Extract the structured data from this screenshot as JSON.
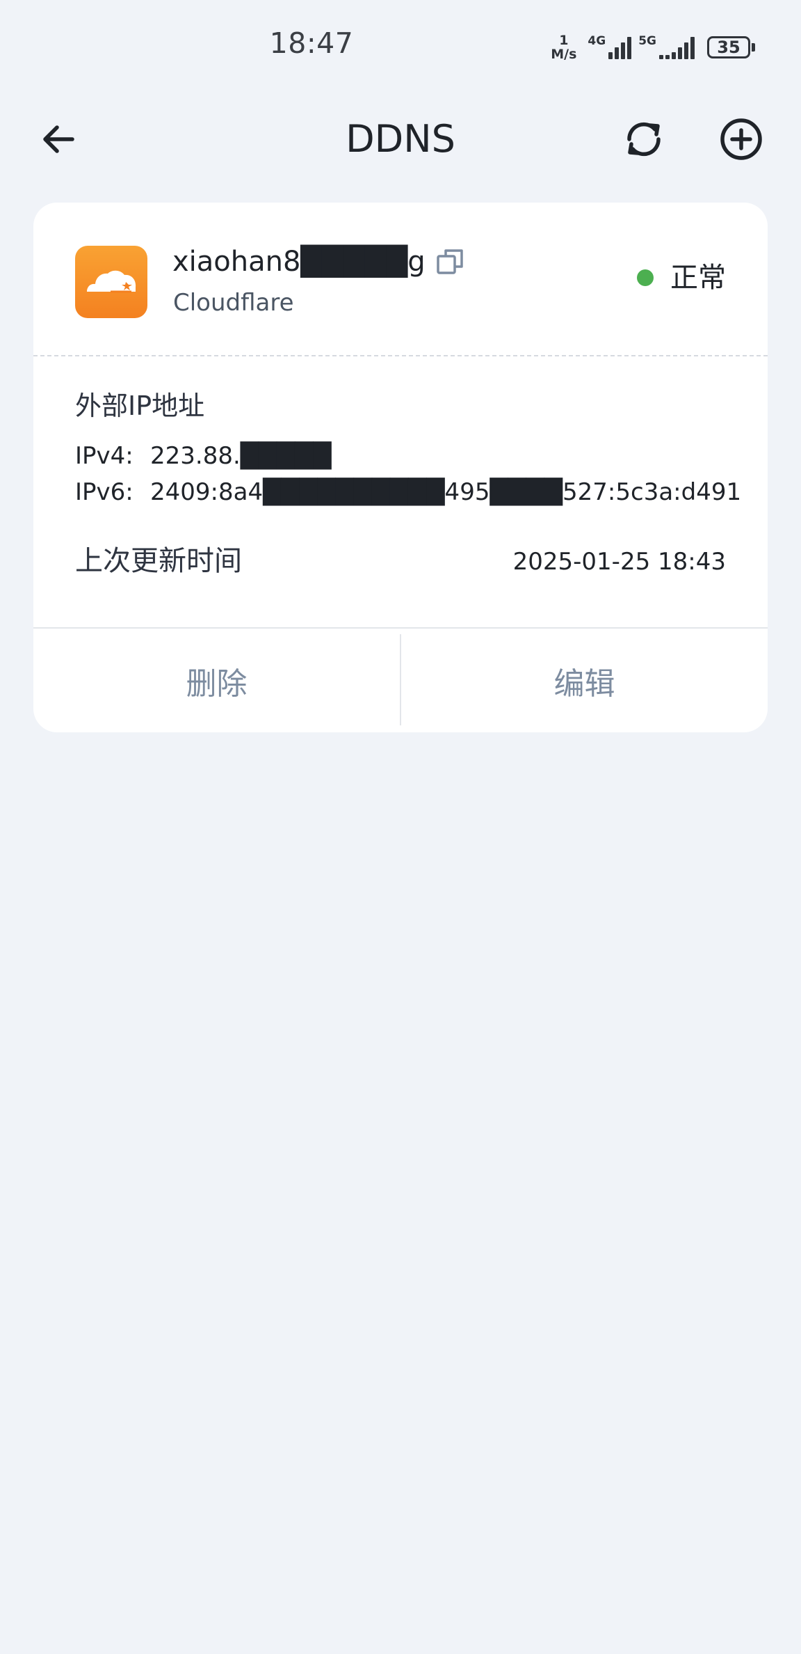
{
  "status_bar": {
    "time": "18:47",
    "net_speed_value": "1",
    "net_speed_unit": "M/s",
    "network_1": "4G",
    "network_2": "5G",
    "battery": "35"
  },
  "header": {
    "title": "DDNS",
    "icons": {
      "back": "arrow-left-icon",
      "refresh": "refresh-icon",
      "add": "plus-circle-icon"
    }
  },
  "ddns_card": {
    "domain": "xiaohan8█████g",
    "provider": "Cloudflare",
    "provider_logo": "cloudflare-logo",
    "status_text": "正常",
    "status_color": "#4CAF50",
    "section_title": "外部IP地址",
    "ipv4_label": "IPv4:",
    "ipv4_value": "223.88.█████",
    "ipv6_label": "IPv6:",
    "ipv6_value": "2409:8a4██████████495████527:5c3a:d491",
    "last_update_label": "上次更新时间",
    "last_update_value": "2025-01-25 18:43",
    "delete_label": "删除",
    "edit_label": "编辑"
  },
  "colors": {
    "background": "#F0F3F8",
    "card": "#FFFFFF",
    "brand_orange": "#F48120",
    "action_text": "#7D8CA0"
  }
}
